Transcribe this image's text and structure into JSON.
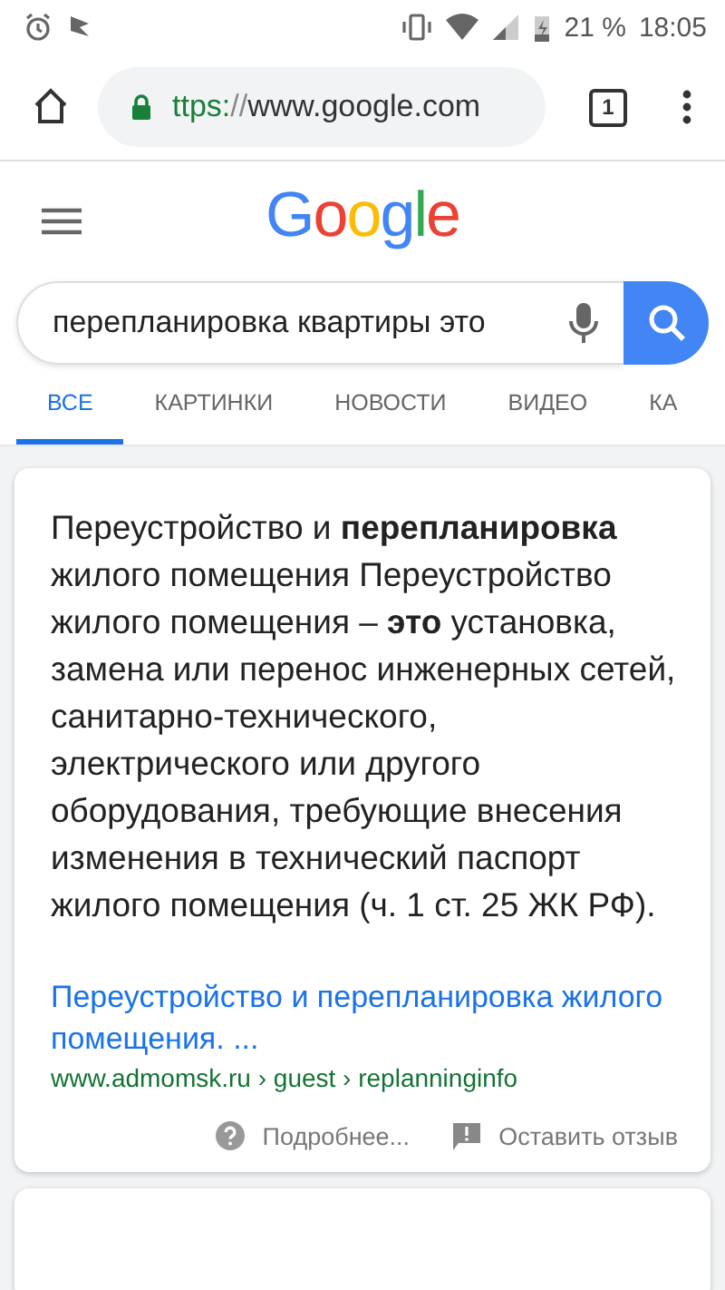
{
  "status_bar": {
    "battery": "21 %",
    "time": "18:05"
  },
  "browser": {
    "url": [
      {
        "text": "ttps:",
        "kind": "scheme"
      },
      {
        "text": "//",
        "kind": "sep"
      },
      {
        "text": "www.google.com",
        "kind": "host"
      }
    ],
    "tab_count": "1"
  },
  "logo": [
    {
      "text": "G",
      "color": "#4285f4"
    },
    {
      "text": "o",
      "color": "#ea4335"
    },
    {
      "text": "o",
      "color": "#fbbc05"
    },
    {
      "text": "g",
      "color": "#4285f4"
    },
    {
      "text": "l",
      "color": "#34a853"
    },
    {
      "text": "e",
      "color": "#ea4335"
    }
  ],
  "search": {
    "value": "перепланировка квартиры это"
  },
  "tabs": [
    {
      "label": "ВСЕ",
      "selected": true
    },
    {
      "label": "КАРТИНКИ",
      "selected": false
    },
    {
      "label": "НОВОСТИ",
      "selected": false
    },
    {
      "label": "ВИДЕО",
      "selected": false
    },
    {
      "label": "КА",
      "selected": false
    }
  ],
  "result": {
    "snippet": "Переустройство и **перепланировка** жилого помещения Переустройство жилого помещения – **это** установка, замена или перенос инженерных сетей, санитарно-технического, электрического или другого оборудования, требующие внесения изменения в технический паспорт жилого помещения (ч. 1 ст. 25 ЖК РФ).",
    "link": "Переустройство и перепланировка жилого помещения. ...",
    "source": "www.admomsk.ru › guest › replanninginfo",
    "more": "Подробнее...",
    "feedback": "Оставить отзыв"
  }
}
